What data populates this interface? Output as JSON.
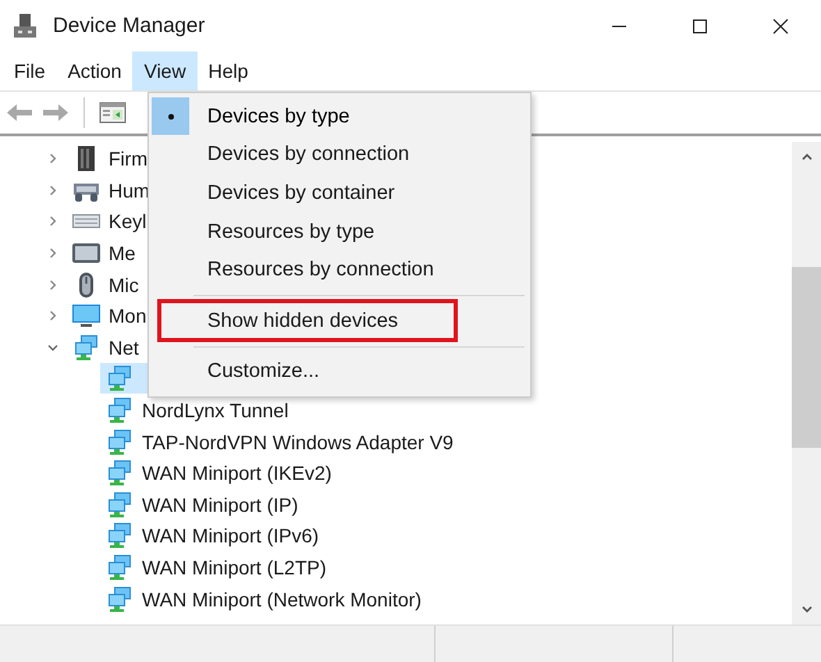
{
  "window": {
    "title": "Device Manager"
  },
  "menu_bar": [
    {
      "label": "File",
      "selected": false
    },
    {
      "label": "Action",
      "selected": false
    },
    {
      "label": "View",
      "selected": true
    },
    {
      "label": "Help",
      "selected": false
    }
  ],
  "view_menu": [
    {
      "kind": "item",
      "label": "Devices by type",
      "checked": true,
      "outlined": false
    },
    {
      "kind": "item",
      "label": "Devices by connection",
      "checked": false,
      "outlined": false
    },
    {
      "kind": "item",
      "label": "Devices by container",
      "checked": false,
      "outlined": false
    },
    {
      "kind": "item",
      "label": "Resources by type",
      "checked": false,
      "outlined": false
    },
    {
      "kind": "item",
      "label": "Resources by connection",
      "checked": false,
      "outlined": false
    },
    {
      "kind": "separator"
    },
    {
      "kind": "item",
      "label": "Show hidden devices",
      "checked": false,
      "outlined": true
    },
    {
      "kind": "separator"
    },
    {
      "kind": "item",
      "label": "Customize...",
      "checked": false,
      "outlined": false
    }
  ],
  "tree": [
    {
      "kind": "firmware",
      "label": "Firm",
      "expanded": false
    },
    {
      "kind": "hid",
      "label": "Hum",
      "expanded": false
    },
    {
      "kind": "keyboard",
      "label": "Keyl",
      "expanded": false
    },
    {
      "kind": "memory",
      "label": "Me",
      "expanded": false
    },
    {
      "kind": "mouse",
      "label": "Mic",
      "expanded": false
    },
    {
      "kind": "monitor",
      "label": "Mon",
      "expanded": false
    },
    {
      "kind": "network",
      "label": "Net",
      "expanded": true,
      "children": [
        {
          "kind": "network",
          "selected": true
        },
        {
          "kind": "network",
          "label": "NordLynx Tunnel",
          "selected": false
        },
        {
          "kind": "network",
          "label": "TAP-NordVPN Windows Adapter V9",
          "selected": false
        },
        {
          "kind": "network",
          "label": "WAN Miniport (IKEv2)",
          "selected": false
        },
        {
          "kind": "network",
          "label": "WAN Miniport (IP)",
          "selected": false
        },
        {
          "kind": "network",
          "label": "WAN Miniport (IPv6)",
          "selected": false
        },
        {
          "kind": "network",
          "label": "WAN Miniport (L2TP)",
          "selected": false
        },
        {
          "kind": "network",
          "label": "WAN Miniport (Network Monitor)",
          "selected": false
        }
      ]
    }
  ]
}
